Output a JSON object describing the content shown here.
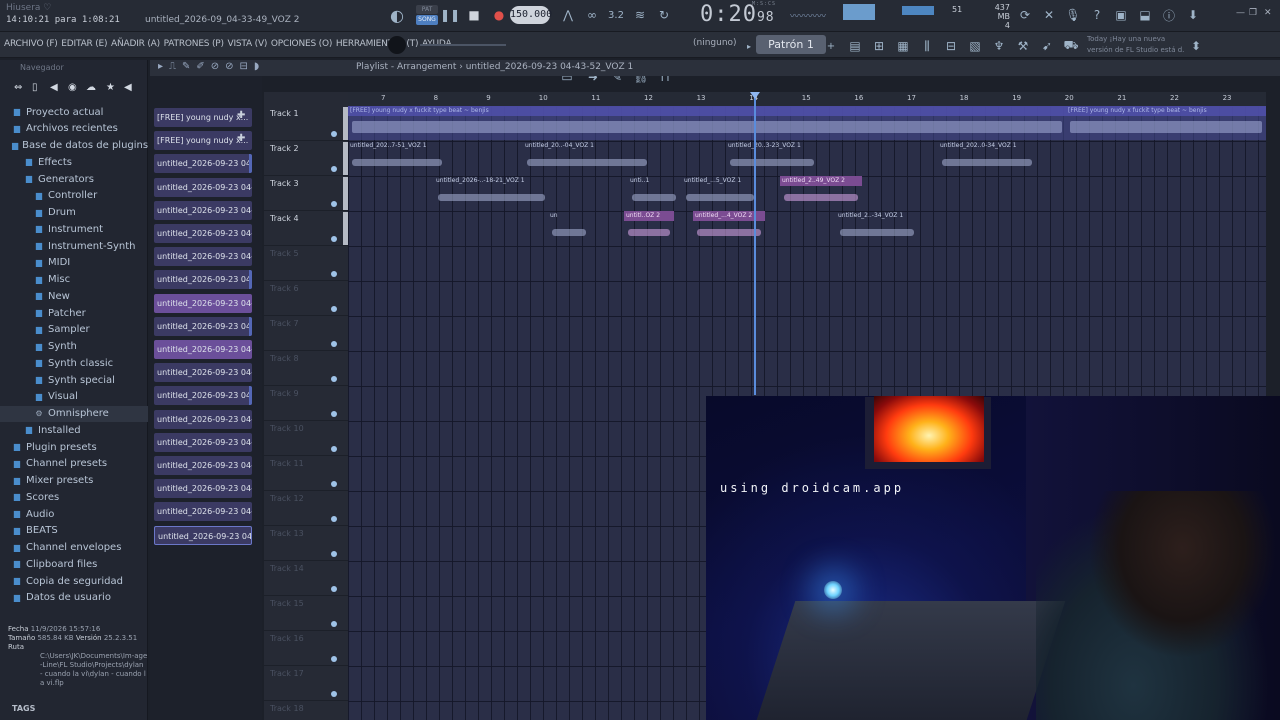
{
  "app": {
    "hint": "Hiusera ♡",
    "time_info": "14:10:21 para 1:08:21",
    "project_name": "untitled_2026-09_04-33-49_VOZ 2"
  },
  "transport": {
    "pat_label": "PAT",
    "song_label": "SONG",
    "tempo": "150.000",
    "time_main": "0:20",
    "time_small": "98",
    "time_unit": "M:S:CS",
    "cpu": "51",
    "memory": "437 MB",
    "voices": "4"
  },
  "menu": {
    "items": [
      "ARCHIVO (F)",
      "EDITAR (E)",
      "AÑADIR (A)",
      "PATRONES (P)",
      "VISTA (V)",
      "OPCIONES (O)",
      "HERRAMIENTAS (T)",
      "AYUDA"
    ],
    "ninguno": "(ninguno)",
    "pattern": "Patrón 1",
    "news_line1": "Today  ¡Hay una nueva",
    "news_line2": "versión de FL Studio está d."
  },
  "browser": {
    "header": "Navegador",
    "tree": [
      {
        "label": "Proyecto actual",
        "indent": 0,
        "icon": "folder-icon"
      },
      {
        "label": "Archivos recientes",
        "indent": 0,
        "icon": "folder-icon"
      },
      {
        "label": "Base de datos de plugins",
        "indent": 0,
        "icon": "folder-icon"
      },
      {
        "label": "Effects",
        "indent": 1,
        "icon": "folder-icon"
      },
      {
        "label": "Generators",
        "indent": 1,
        "icon": "folder-icon"
      },
      {
        "label": "Controller",
        "indent": 2,
        "icon": "folder-icon"
      },
      {
        "label": "Drum",
        "indent": 2,
        "icon": "folder-icon"
      },
      {
        "label": "Instrument",
        "indent": 2,
        "icon": "folder-icon"
      },
      {
        "label": "Instrument-Synth",
        "indent": 2,
        "icon": "folder-icon"
      },
      {
        "label": "MIDI",
        "indent": 2,
        "icon": "folder-icon"
      },
      {
        "label": "Misc",
        "indent": 2,
        "icon": "folder-icon"
      },
      {
        "label": "New",
        "indent": 2,
        "icon": "folder-icon"
      },
      {
        "label": "Patcher",
        "indent": 2,
        "icon": "folder-icon"
      },
      {
        "label": "Sampler",
        "indent": 2,
        "icon": "folder-icon"
      },
      {
        "label": "Synth",
        "indent": 2,
        "icon": "folder-icon"
      },
      {
        "label": "Synth classic",
        "indent": 2,
        "icon": "folder-icon"
      },
      {
        "label": "Synth special",
        "indent": 2,
        "icon": "folder-icon"
      },
      {
        "label": "Visual",
        "indent": 2,
        "icon": "folder-icon"
      },
      {
        "label": "Omnisphere",
        "indent": 2,
        "icon": "plugin-icon",
        "selected": true
      },
      {
        "label": "Installed",
        "indent": 1,
        "icon": "folder-icon"
      },
      {
        "label": "Plugin presets",
        "indent": 0,
        "icon": "folder-icon"
      },
      {
        "label": "Channel presets",
        "indent": 0,
        "icon": "folder-icon"
      },
      {
        "label": "Mixer presets",
        "indent": 0,
        "icon": "folder-icon"
      },
      {
        "label": "Scores",
        "indent": 0,
        "icon": "folder-icon"
      },
      {
        "label": "Audio",
        "indent": 0,
        "icon": "folder-icon"
      },
      {
        "label": "BEATS",
        "indent": 0,
        "icon": "folder-icon"
      },
      {
        "label": "Channel envelopes",
        "indent": 0,
        "icon": "folder-icon"
      },
      {
        "label": "Clipboard files",
        "indent": 0,
        "icon": "folder-icon"
      },
      {
        "label": "Copia de seguridad",
        "indent": 0,
        "icon": "folder-icon"
      },
      {
        "label": "Datos de usuario",
        "indent": 0,
        "icon": "folder-icon"
      }
    ],
    "info": {
      "fecha_label": "Fecha",
      "fecha": "11/9/2026 15:57:16",
      "tamano_label": "Tamaño",
      "tamano": "585.84 KB",
      "version_label": "Versión",
      "version": "25.2.3.51",
      "ruta_label": "Ruta",
      "ruta": "C:\\Users\\JK\\Documents\\Im-age-Line\\FL Studio\\Projects\\dylan - cuando la vi\\dylan - cuando la vi.flp"
    },
    "tags": "TAGS"
  },
  "picker": {
    "items": [
      {
        "label": "[FREE] young nudy x...",
        "style": "plus"
      },
      {
        "label": "[FREE] young nudy x...",
        "style": "plus"
      },
      {
        "label": "untitled_2026-09-23 04-...",
        "style": "bar"
      },
      {
        "label": "untitled_2026-09-23 04-...",
        "style": ""
      },
      {
        "label": "untitled_2026-09-23 04-...",
        "style": ""
      },
      {
        "label": "untitled_2026-09-23 04-...",
        "style": ""
      },
      {
        "label": "untitled_2026-09-23 04-...",
        "style": ""
      },
      {
        "label": "untitled_2026-09-23 04-...",
        "style": "bar"
      },
      {
        "label": "untitled_2026-09-23 04-...",
        "style": "hl"
      },
      {
        "label": "untitled_2026-09-23 04-...",
        "style": "bar"
      },
      {
        "label": "untitled_2026-09-23 04-...",
        "style": "hl"
      },
      {
        "label": "untitled_2026-09-23 04-...",
        "style": ""
      },
      {
        "label": "untitled_2026-09-23 04-...",
        "style": "bar"
      },
      {
        "label": "untitled_2026-09-23 04-...",
        "style": ""
      },
      {
        "label": "untitled_2026-09-23 04-...",
        "style": ""
      },
      {
        "label": "untitled_2026-09-23 04-...",
        "style": ""
      },
      {
        "label": "untitled_2026-09-23 04-...",
        "style": ""
      },
      {
        "label": "untitled_2026-09-23 04-...",
        "style": ""
      },
      {
        "label": "untitled_2026-09-23 04-...",
        "style": "sel"
      }
    ]
  },
  "playlist": {
    "title": "Playlist - Arrangement",
    "project": "untitled_2026-09-23 04-43-52_VOZ 1",
    "ruler": [
      "7",
      "8",
      "9",
      "10",
      "11",
      "12",
      "13",
      "14",
      "15",
      "16",
      "17",
      "18",
      "19",
      "20",
      "21",
      "22",
      "23"
    ],
    "tracks": [
      "Track 1",
      "Track 2",
      "Track 3",
      "Track 4",
      "Track 5",
      "Track 6",
      "Track 7",
      "Track 8",
      "Track 9",
      "Track 10",
      "Track 11",
      "Track 12",
      "Track 13",
      "Track 14",
      "Track 15",
      "Track 16",
      "Track 17",
      "Track 18"
    ],
    "clips": [
      {
        "track": 0,
        "label": "[FREE] young nudy x fuckit type beat ~ benjis",
        "style": "big"
      },
      {
        "track": 0,
        "label": "[FREE] young nudy x fuckit type beat ~ benjis",
        "style": "big"
      },
      {
        "track": 1,
        "label": "untitled_202..7-51_VOZ 1",
        "style": ""
      },
      {
        "track": 1,
        "label": "untitled_20..-04_VOZ 1",
        "style": ""
      },
      {
        "track": 1,
        "label": "untitled_20..3-23_VOZ 1",
        "style": ""
      },
      {
        "track": 1,
        "label": "untitled_202..0-34_VOZ 1",
        "style": ""
      },
      {
        "track": 2,
        "label": "untitled_2026-..-18-21_VOZ 1",
        "style": ""
      },
      {
        "track": 2,
        "label": "unti..1",
        "style": ""
      },
      {
        "track": 2,
        "label": "untitled_...5_VOZ 1",
        "style": ""
      },
      {
        "track": 2,
        "label": "untitled_2..49_VOZ 2",
        "style": "pink"
      },
      {
        "track": 3,
        "label": "un",
        "style": ""
      },
      {
        "track": 3,
        "label": "untitl..OZ 2",
        "style": "pink"
      },
      {
        "track": 3,
        "label": "untitled_...4_VOZ 2",
        "style": "pink"
      },
      {
        "track": 3,
        "label": "untitled_2..-34_VOZ 1",
        "style": ""
      }
    ]
  },
  "webcam": {
    "label": "using droidcam.app"
  }
}
